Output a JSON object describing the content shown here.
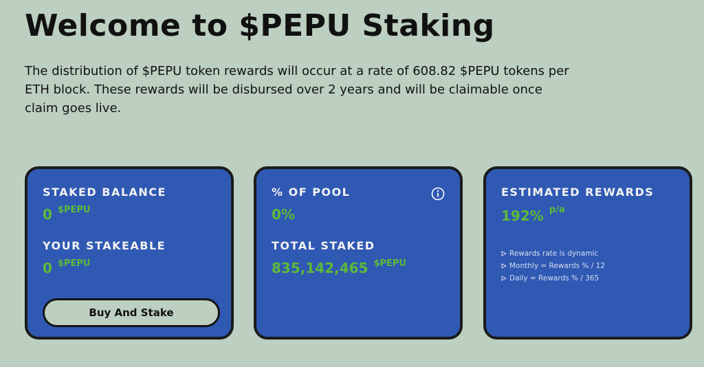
{
  "page": {
    "title": "Welcome to $PEPU Staking",
    "intro": "The distribution of $PEPU token rewards will occur at a rate of 608.82 $PEPU tokens per ETH block. These rewards will be disbursed over 2 years and will be claimable once claim goes live."
  },
  "staked_card": {
    "staked_label": "STAKED BALANCE",
    "staked_value": "0",
    "staked_unit": "$PEPU",
    "stakeable_label": "YOUR STAKEABLE",
    "stakeable_value": "0",
    "stakeable_unit": "$PEPU",
    "button_label": "Buy And Stake"
  },
  "pool_card": {
    "pool_label": "% OF POOL",
    "pool_value": "0%",
    "info_icon": "info-circle-icon",
    "total_label": "TOTAL STAKED",
    "total_value": "835,142,465",
    "total_unit": "$PEPU"
  },
  "rewards_card": {
    "label": "ESTIMATED REWARDS",
    "value": "192%",
    "unit": "p/a",
    "bullets": [
      "Rewards rate is dynamic",
      "Monthly = Rewards % / 12",
      "Daily = Rewards % / 365"
    ]
  },
  "colors": {
    "background": "#bccfc0",
    "card": "#2f59b3",
    "accent_green": "#5dba3a",
    "border": "#1b1b1b"
  }
}
